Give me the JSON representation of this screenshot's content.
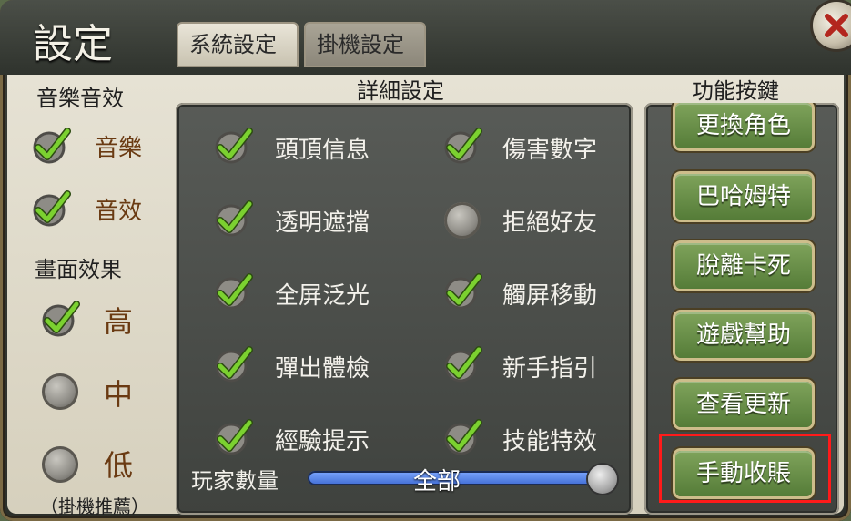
{
  "window": {
    "title": "設定"
  },
  "tabs": [
    {
      "label": "系統設定",
      "active": true
    },
    {
      "label": "掛機設定",
      "active": false
    }
  ],
  "left_panel": {
    "audio_section_title": "音樂音效",
    "music_label": "音樂",
    "music_checked": true,
    "sfx_label": "音效",
    "sfx_checked": true,
    "graphics_section_title": "畫面效果",
    "quality_options": [
      {
        "label": "高",
        "selected": true
      },
      {
        "label": "中",
        "selected": false
      },
      {
        "label": "低",
        "selected": false
      }
    ],
    "low_note": "（掛機推薦）"
  },
  "detail_panel": {
    "title": "詳細設定",
    "options": [
      {
        "label": "頭頂信息",
        "checked": true
      },
      {
        "label": "傷害數字",
        "checked": true
      },
      {
        "label": "透明遮擋",
        "checked": true
      },
      {
        "label": "拒絕好友",
        "checked": false
      },
      {
        "label": "全屏泛光",
        "checked": true
      },
      {
        "label": "觸屏移動",
        "checked": true
      },
      {
        "label": "彈出體檢",
        "checked": true
      },
      {
        "label": "新手指引",
        "checked": true
      },
      {
        "label": "經驗提示",
        "checked": true
      },
      {
        "label": "技能特效",
        "checked": true
      }
    ],
    "player_count_label": "玩家數量",
    "player_count_value": "全部",
    "player_count_fraction": 1.0
  },
  "function_panel": {
    "title": "功能按鍵",
    "buttons": [
      {
        "label": "更換角色"
      },
      {
        "label": "巴哈姆特"
      },
      {
        "label": "脫離卡死"
      },
      {
        "label": "遊戲幫助"
      },
      {
        "label": "查看更新"
      },
      {
        "label": "手動收賬"
      }
    ],
    "highlighted_button_index": 5
  },
  "colors": {
    "check_green": "#7bd130",
    "button_green": "#6b9148",
    "highlight_red": "#ff1a1a",
    "slider_blue": "#4a78e6"
  }
}
